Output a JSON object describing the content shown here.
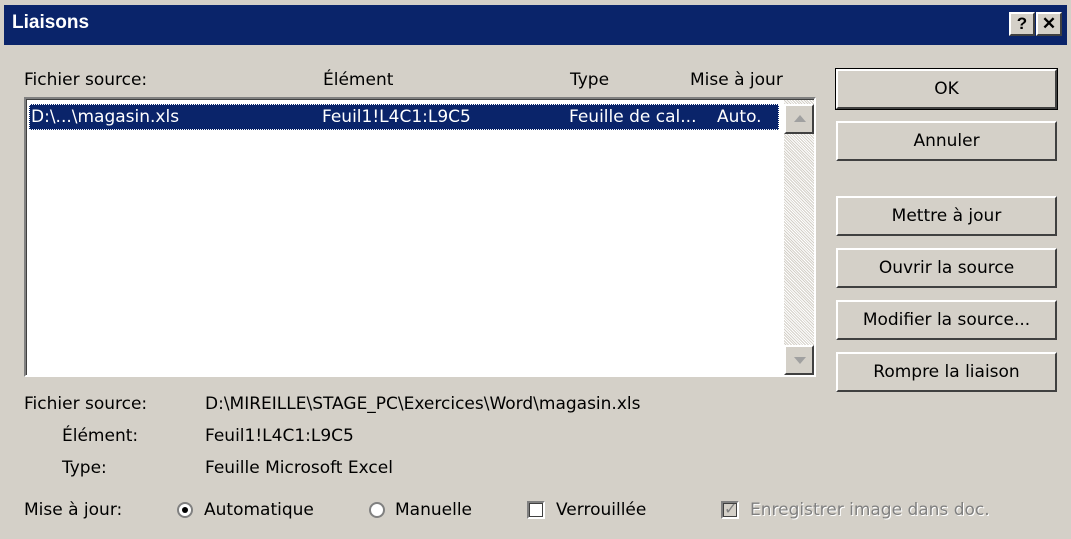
{
  "window": {
    "title": "Liaisons",
    "help_glyph": "?",
    "close_glyph": "✕"
  },
  "columns": {
    "source": "Fichier source:",
    "element": "Élément",
    "type": "Type",
    "update": "Mise à jour"
  },
  "links": [
    {
      "source": "D:\\...\\magasin.xls",
      "element": "Feuil1!L4C1:L9C5",
      "type": "Feuille de cal...",
      "update": "Auto."
    }
  ],
  "buttons": {
    "ok": "OK",
    "cancel": "Annuler",
    "update_now": "Mettre à jour",
    "open_source": "Ouvrir la source",
    "change_source": "Modifier la source...",
    "break_link": "Rompre la liaison"
  },
  "details": {
    "source_label": "Fichier source:",
    "source_value": "D:\\MIREILLE\\STAGE_PC\\Exercices\\Word\\magasin.xls",
    "element_label": "Élément:",
    "element_value": "Feuil1!L4C1:L9C5",
    "type_label": "Type:",
    "type_value": "Feuille Microsoft Excel"
  },
  "update_options": {
    "label": "Mise à jour:",
    "automatic": "Automatique",
    "manual": "Manuelle",
    "locked": "Verrouillée",
    "save_picture": "Enregistrer image dans doc.",
    "selected": "automatic"
  },
  "colors": {
    "titlebar": "#0a246a",
    "face": "#d4d0c8",
    "selection": "#0a246a"
  }
}
